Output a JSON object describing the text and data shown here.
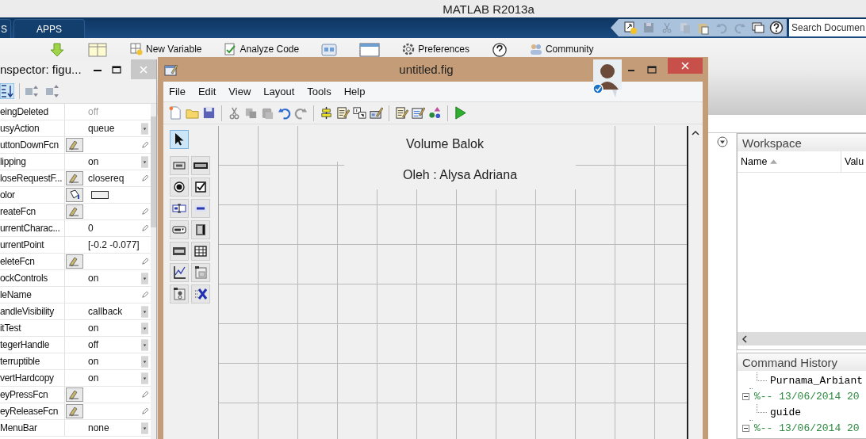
{
  "window": {
    "title": "MATLAB R2013a"
  },
  "ribbon_tabs": [
    {
      "label": "S",
      "selected": false
    },
    {
      "label": "APPS",
      "selected": false
    }
  ],
  "search": {
    "placeholder": "Search Documen"
  },
  "ribbon": [
    {
      "kind": "import"
    },
    {
      "kind": "layout"
    },
    {
      "kind": "variable",
      "label": "New Variable"
    },
    {
      "kind": "analyze",
      "label": "Analyze Code"
    },
    {
      "kind": "simulink"
    },
    {
      "kind": "window"
    },
    {
      "kind": "preferences",
      "label": "Preferences"
    },
    {
      "kind": "help"
    },
    {
      "kind": "community",
      "label": "Community"
    }
  ],
  "inspector": {
    "title": "nspector:  figu...",
    "properties": [
      {
        "name": "eingDeleted",
        "value": "off",
        "kind": "readonly"
      },
      {
        "name": "usyAction",
        "value": "queue",
        "kind": "dropdown"
      },
      {
        "name": "uttonDownFcn",
        "kind": "callback"
      },
      {
        "name": "lipping",
        "value": "on",
        "kind": "dropdown"
      },
      {
        "name": "loseRequestF...",
        "value": "closereq",
        "kind": "callback"
      },
      {
        "name": "olor",
        "kind": "color"
      },
      {
        "name": "reateFcn",
        "kind": "callback"
      },
      {
        "name": "urrentCharac...",
        "value": "0",
        "kind": "edit"
      },
      {
        "name": "urrentPoint",
        "value": "[-0.2 -0.077]",
        "kind": "plain"
      },
      {
        "name": "eleteFcn",
        "kind": "callback"
      },
      {
        "name": "ockControls",
        "value": "on",
        "kind": "dropdown"
      },
      {
        "name": "leName",
        "kind": "edit"
      },
      {
        "name": "andleVisibility",
        "value": "callback",
        "kind": "dropdown"
      },
      {
        "name": "itTest",
        "value": "on",
        "kind": "dropdown"
      },
      {
        "name": "tegerHandle",
        "value": "off",
        "kind": "dropdown"
      },
      {
        "name": "terruptible",
        "value": "on",
        "kind": "dropdown"
      },
      {
        "name": "vertHardcopy",
        "value": "on",
        "kind": "dropdown"
      },
      {
        "name": "eyPressFcn",
        "kind": "callback"
      },
      {
        "name": "eyReleaseFcn",
        "kind": "callback"
      },
      {
        "name": "MenuBar",
        "value": "none",
        "kind": "dropdown"
      }
    ]
  },
  "figure_window": {
    "title": "untitled.fig",
    "menu": [
      "File",
      "Edit",
      "View",
      "Layout",
      "Tools",
      "Help"
    ],
    "palette": [
      {
        "kind": "select",
        "selected": true
      },
      {
        "kind": "pushbutton",
        "selected": false
      },
      {
        "kind": "slider",
        "selected": false
      },
      {
        "kind": "radio",
        "selected": false
      },
      {
        "kind": "checkbox",
        "selected": false
      },
      {
        "kind": "edit",
        "selected": false
      },
      {
        "kind": "text",
        "selected": false
      },
      {
        "kind": "popup",
        "selected": false
      },
      {
        "kind": "listbox",
        "selected": false
      },
      {
        "kind": "toggle",
        "selected": false
      },
      {
        "kind": "table",
        "selected": false
      },
      {
        "kind": "axes",
        "selected": false
      },
      {
        "kind": "panel",
        "selected": false
      },
      {
        "kind": "buttongroup",
        "selected": false
      },
      {
        "kind": "activex",
        "selected": false
      }
    ],
    "canvas_texts": [
      "Volume Balok",
      "Oleh : Alysa Adriana"
    ]
  },
  "workspace": {
    "title": "Workspace",
    "columns": [
      "Name",
      "Valu"
    ]
  },
  "command_history": {
    "title": "Command History",
    "entries": [
      {
        "kind": "command",
        "text": "Purnama_Arbiant"
      },
      {
        "kind": "session",
        "text": "%-- 13/06/2014 20",
        "expanded": true,
        "children": [
          {
            "kind": "command",
            "text": "guide"
          }
        ]
      },
      {
        "kind": "session",
        "text": "%-- 13/06/2014 20",
        "expanded": true
      }
    ]
  }
}
